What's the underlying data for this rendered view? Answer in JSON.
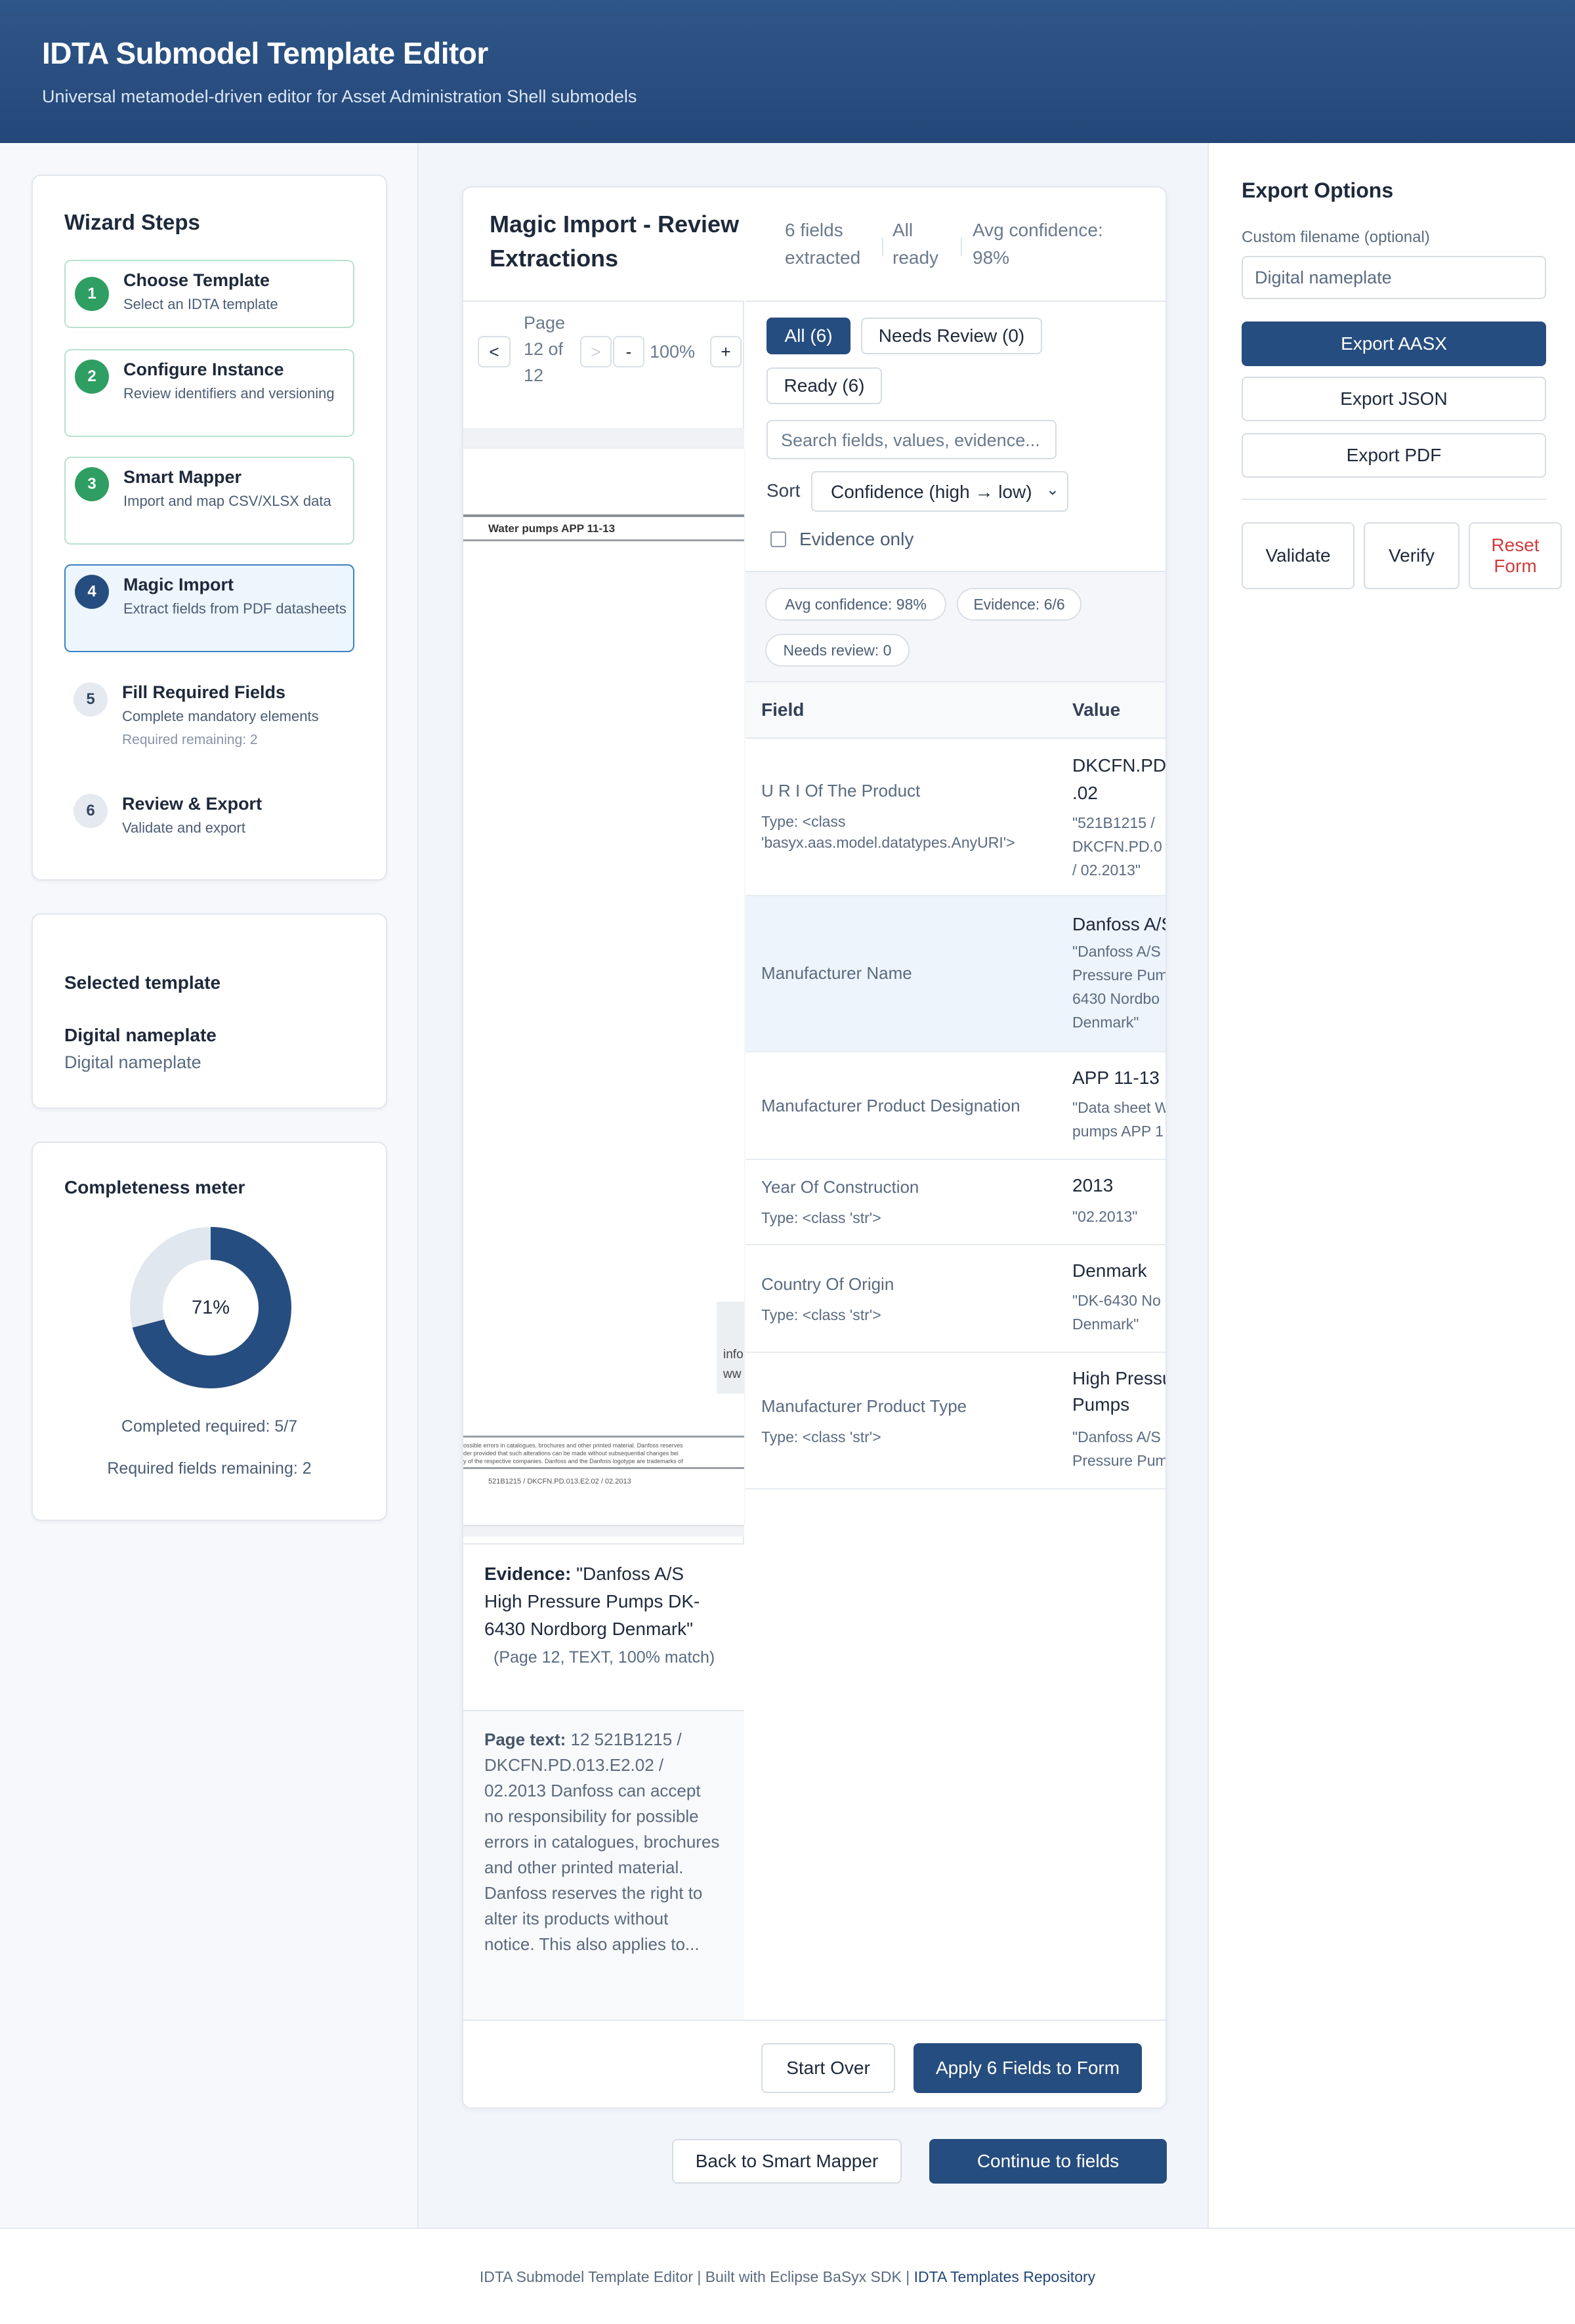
{
  "header": {
    "title": "IDTA Submodel Template Editor",
    "subtitle": "Universal metamodel-driven editor for Asset Administration Shell submodels"
  },
  "wizard": {
    "title": "Wizard Steps",
    "steps": [
      {
        "num": "1",
        "title": "Choose Template",
        "desc": "Select an IDTA template",
        "state": "done"
      },
      {
        "num": "2",
        "title": "Configure Instance",
        "desc": "Review identifiers and versioning",
        "state": "done"
      },
      {
        "num": "3",
        "title": "Smart Mapper",
        "desc": "Import and map CSV/XLSX data",
        "state": "done"
      },
      {
        "num": "4",
        "title": "Magic Import",
        "desc": "Extract fields from PDF datasheets",
        "state": "active"
      },
      {
        "num": "5",
        "title": "Fill Required Fields",
        "desc": "Complete mandatory elements",
        "extra": "Required remaining: 2",
        "state": "pending"
      },
      {
        "num": "6",
        "title": "Review & Export",
        "desc": "Validate and export",
        "state": "pending"
      }
    ]
  },
  "selected": {
    "title": "Selected template",
    "name": "Digital nameplate",
    "sub": "Digital nameplate"
  },
  "completeness": {
    "title": "Completeness meter",
    "percent_label": "71%",
    "fraction": 0.71,
    "completed": "Completed required: 5/7",
    "remaining": "Required fields remaining: 2",
    "colors": {
      "fill": "#264d7f",
      "track": "#e1e7ef"
    }
  },
  "magic": {
    "title": "Magic Import - Review Extractions",
    "stats": {
      "extracted": "6 fields extracted",
      "ready": "All ready",
      "avg": "Avg confidence: 98%"
    },
    "viewer": {
      "prev": "<",
      "next": ">",
      "page_label": "Page",
      "page_value": "12 of",
      "page_total": "12",
      "zoom_out": "-",
      "zoom": "100%",
      "zoom_in": "+",
      "doc_heading": "Water pumps APP 11-13",
      "doc_side": [
        "info",
        "ww"
      ],
      "doc_fine_1": "ossible errors in catalogues, brochures and other printed material. Danfoss reserves",
      "doc_fine_2": "der provided that such alterations can be made without subsequential changes bei",
      "doc_fine_3": "y of the respective companies. Danfoss and the Danfoss logotype are trademarks of",
      "doc_code": "521B1215 / DKCFN.PD.013.E2.02 / 02.2013"
    },
    "evidence": {
      "label": "Evidence:",
      "text": "\"Danfoss A/S High Pressure Pumps DK-6430 Nordborg Denmark\"",
      "meta": "(Page 12, TEXT, 100% match)"
    },
    "page_text": {
      "label": "Page text:",
      "text": "12 521B1215 / DKCFN.PD.013.E2.02 / 02.2013 Danfoss can accept no responsibility for possible errors in catalogues, brochures and other printed material. Danfoss reserves the right to alter its products without notice. This also applies to..."
    },
    "filters": {
      "all": "All (6)",
      "needs_review": "Needs Review (0)",
      "ready": "Ready (6)"
    },
    "search_placeholder": "Search fields, values, evidence...",
    "sort_label": "Sort",
    "sort_value": "Confidence (high → low)",
    "evidence_only": "Evidence only",
    "chips": {
      "avg": "Avg confidence: 98%",
      "evidence": "Evidence: 6/6",
      "needs": "Needs review: 0"
    },
    "table": {
      "headers": {
        "field": "Field",
        "value": "Value"
      },
      "rows": [
        {
          "field": "U R I Of The Product",
          "type": "Type: <class 'basyx.aas.model.datatypes.AnyURI'>",
          "value": [
            "DKCFN.PD.",
            ".02"
          ],
          "quote": [
            "\"521B1215 /",
            "DKCFN.PD.0",
            "/ 02.2013\""
          ]
        },
        {
          "field": "Manufacturer Name",
          "type": "",
          "value": [
            "Danfoss A/S"
          ],
          "quote": [
            "\"Danfoss A/S",
            "Pressure Pum",
            "6430 Nordbo",
            "Denmark\""
          ]
        },
        {
          "field": "Manufacturer Product Designation",
          "type": "",
          "value": [
            "APP 11-13"
          ],
          "quote": [
            "\"Data sheet W",
            "pumps APP 1"
          ]
        },
        {
          "field": "Year Of Construction",
          "type": "Type: <class 'str'>",
          "value": [
            "2013"
          ],
          "quote": [
            "\"02.2013\""
          ]
        },
        {
          "field": "Country Of Origin",
          "type": "Type: <class 'str'>",
          "value": [
            "Denmark"
          ],
          "quote": [
            "\"DK-6430 No",
            "Denmark\""
          ]
        },
        {
          "field": "Manufacturer Product Type",
          "type": "Type: <class 'str'>",
          "value": [
            "High Pressu",
            "Pumps"
          ],
          "quote": [
            "\"Danfoss A/S",
            "Pressure Pum"
          ]
        }
      ]
    },
    "start_over": "Start Over",
    "apply": "Apply 6 Fields to Form"
  },
  "nav": {
    "back": "Back to Smart Mapper",
    "continue": "Continue to fields"
  },
  "export": {
    "title": "Export Options",
    "filename_label": "Custom filename (optional)",
    "filename_placeholder": "Digital nameplate",
    "aasx": "Export AASX",
    "json": "Export JSON",
    "pdf": "Export PDF",
    "validate": "Validate",
    "verify": "Verify",
    "reset": "Reset Form"
  },
  "footer": {
    "text": "IDTA Submodel Template Editor | Built with Eclipse BaSyx SDK | ",
    "link": "IDTA Templates Repository"
  }
}
